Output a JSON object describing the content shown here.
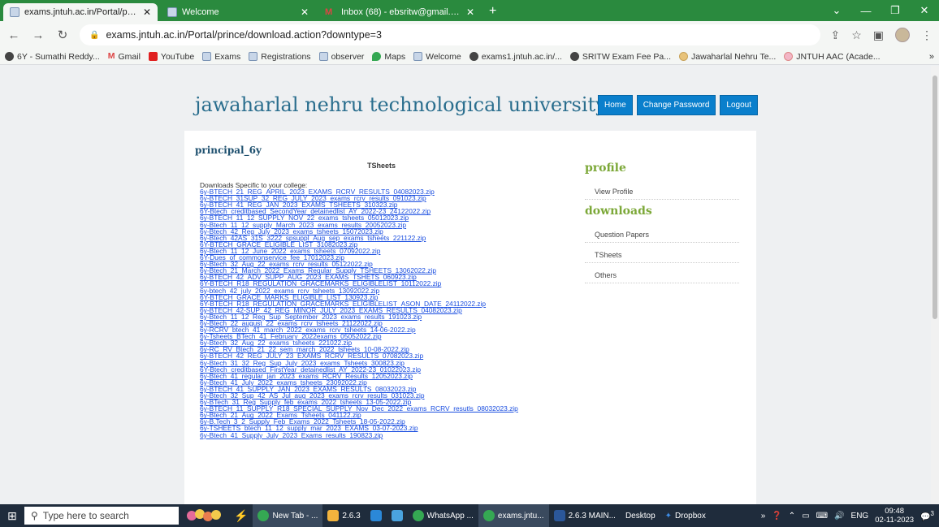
{
  "browser": {
    "tabs": [
      {
        "title": "exams.jntuh.ac.in/Portal/prince/",
        "active": true,
        "icon": "site-favicon"
      },
      {
        "title": "Welcome",
        "active": false,
        "icon": "site-favicon"
      },
      {
        "title": "Inbox (68) - ebsritw@gmail.com",
        "active": false,
        "icon": "gmail-icon"
      }
    ],
    "new_tab": "+",
    "url": "exams.jntuh.ac.in/Portal/prince/download.action?downtype=3",
    "bookmarks": [
      {
        "label": "6Y - Sumathi Reddy...",
        "icon": "globe"
      },
      {
        "label": "Gmail",
        "icon": "gmail"
      },
      {
        "label": "YouTube",
        "icon": "youtube"
      },
      {
        "label": "Exams",
        "icon": "site"
      },
      {
        "label": "Registrations",
        "icon": "site"
      },
      {
        "label": "observer",
        "icon": "site"
      },
      {
        "label": "Maps",
        "icon": "maps"
      },
      {
        "label": "Welcome",
        "icon": "site"
      },
      {
        "label": "exams1.jntuh.ac.in/...",
        "icon": "globe"
      },
      {
        "label": "SRITW Exam Fee Pa...",
        "icon": "globe"
      },
      {
        "label": "Jawaharlal Nehru Te...",
        "icon": "seal"
      },
      {
        "label": "JNTUH AAC (Acade...",
        "icon": "seal-pink"
      }
    ],
    "bookmarks_more": "»"
  },
  "site": {
    "title": "jawaharlal nehru technological university",
    "nav": [
      "Home",
      "Change Password",
      "Logout"
    ],
    "user": "principal_6y",
    "section_heading": "TSheets",
    "intro": "Downloads Specific to your college:",
    "files": [
      "6y-BTECH_21_REG_APRIL_2023_EXAMS_RCRV_RESULTS_04082023.zip",
      "6y-BTECH_31SUP_32_REG_JULY_2023_exams_rcrv_results_091023.zip",
      "6y-BTECH_41_REG_JAN_2023_EXAMS_TSHEETS_310323.zip",
      "6Y-Btech_creditbased_SecondYear_detainedlist_AY_2022-23_24122022.zip",
      "6y-BTECH_11_12_SUPPLY_NOV_22_exams_tsheets_05012023.zip",
      "6y-Btech_11_12_supply_March_2023_exams_results_20052023.zip",
      "6y-Btech_42_Reg_July_2023_exams_tsheets_15072023.zip",
      "6y-Btech_42AS_31S_3222_spsuppl_Aug_sep_exams_tsheets_221122.zip",
      "6Y-BTECH_GRACE_ELIGIBLE_LIST_31082023.zip",
      "6y-Btech_11_12_June_2022_exams_tsheets_07092022.zip",
      "6Y-Dues_of_commonservice_fee_17012023.zip",
      "6y-Btech_32_Aug_22_exams_rcrv_results_05122022.zip",
      "6y-Btech_21_March_2022_Exams_Regular_Supply_TSHEETS_13062022.zip",
      "6y-BTECH_42_ADV_SUPP_AUG_2023_EXAMS_TSHETS_060923.zip",
      "6Y-BTECH_R18_REGULATION_GRACEMARKS_ELIGIBLELIST_10112022.zip",
      "6y-btech_42_july_2022_exams_rcrv_tsheets_13092022.zip",
      "6Y-BTECH_GRACE_MARKS_ELIGIBLE_LIST_130923.zip",
      "6Y-BTECH_R18_REGULATION_GRACEMARKS_ELIGIBLELIST_ASON_DATE_24112022.zip",
      "6y-BTECH_42-SUP_42_REG_MINOR_JULY_2023_EXAMS_RESULTS_04082023.zip",
      "6y-Btech_11_12_Reg_Sup_September_2023_exams_results_191023.zip",
      "6y-Btech_22_august_22_exams_rcrv_tsheets_21122022.zip",
      "6y-RCRV_btech_41_march_2022_exams_rcrv_tsheets_14-06-2022.zip",
      "6y-Tsheets_BTech_41_February_2022exams_05052022.zip",
      "6y-Btech_32_Aug_22_exams_tsheets_221022.zip",
      "6y-RC_RV_Btech_21_22_sem_march_2022_tsheets_10-08-2022.zip",
      "6y-BTECH_42_REG_JULY_23_EXAMS_RCRV_RESULTS_07082023.zip",
      "6y-Btech_31_32_Reg_Sup_July_2023_exams_Tsheets_300823.zip",
      "6Y-Btech_creditbased_FirstYear_detainedlist_AY_2022-23_01022023.zip",
      "6y-Btech_41_regular_jan_2023_exams_RCRV_Results_12052023.zip",
      "6y-Btech_41_July_2022_exams_tsheets_23092022.zip",
      "6y-BTECH_41_SUPPLY_JAN_2023_EXAMS_RESULTS_08032023.zip",
      "6y-Btech_32_Sup_42_AS_Jul_aug_2023_exams_rcrv_results_031023.zip",
      "6y-BTech_31_Reg_Supply_feb_exams_2022_tsheets_13-05-2022.zip",
      "6y-BTECH_11_SUPPLY_R18_SPECIAL_SUPPLY_Nov_Dec_2022_exams_RCRV_resutls_08032023.zip",
      "6y-Btech_21_Aug_2022_Exams_Tsheets_041122.zip",
      "6y-B.Tech_3_2_Supply_Feb_Exams_2022_Tsheets_18-05-2022.zip",
      "6y-TSHEETS_btech_11_12_supply_mar_2023_EXAMS_03-07-2023.zip",
      "6y-Btech_41_Supply_July_2023_Exams_results_190823.zip"
    ],
    "sidebar": {
      "profile_heading": "profile",
      "profile_items": [
        "View Profile"
      ],
      "downloads_heading": "downloads",
      "download_items": [
        "Question Papers",
        "TSheets",
        "Others"
      ]
    }
  },
  "taskbar": {
    "search_placeholder": "Type here to search",
    "apps": [
      {
        "label": "New Tab - ...",
        "color": "#35a853"
      },
      {
        "label": "2.6.3",
        "color": "#f2b33d"
      },
      {
        "label": "",
        "color": "#2b88d8"
      },
      {
        "label": "",
        "color": "#4aa3df"
      },
      {
        "label": "WhatsApp ...",
        "color": "#35a853"
      },
      {
        "label": "exams.jntu...",
        "color": "#35a853"
      },
      {
        "label": "2.6.3 MAIN...",
        "color": "#2b579a"
      }
    ],
    "desktop_label": "Desktop",
    "dropbox_label": "Dropbox",
    "tray_chevron": "»",
    "lang": "ENG",
    "time": "09:48",
    "date": "02-11-2023",
    "notif_count": "3"
  }
}
